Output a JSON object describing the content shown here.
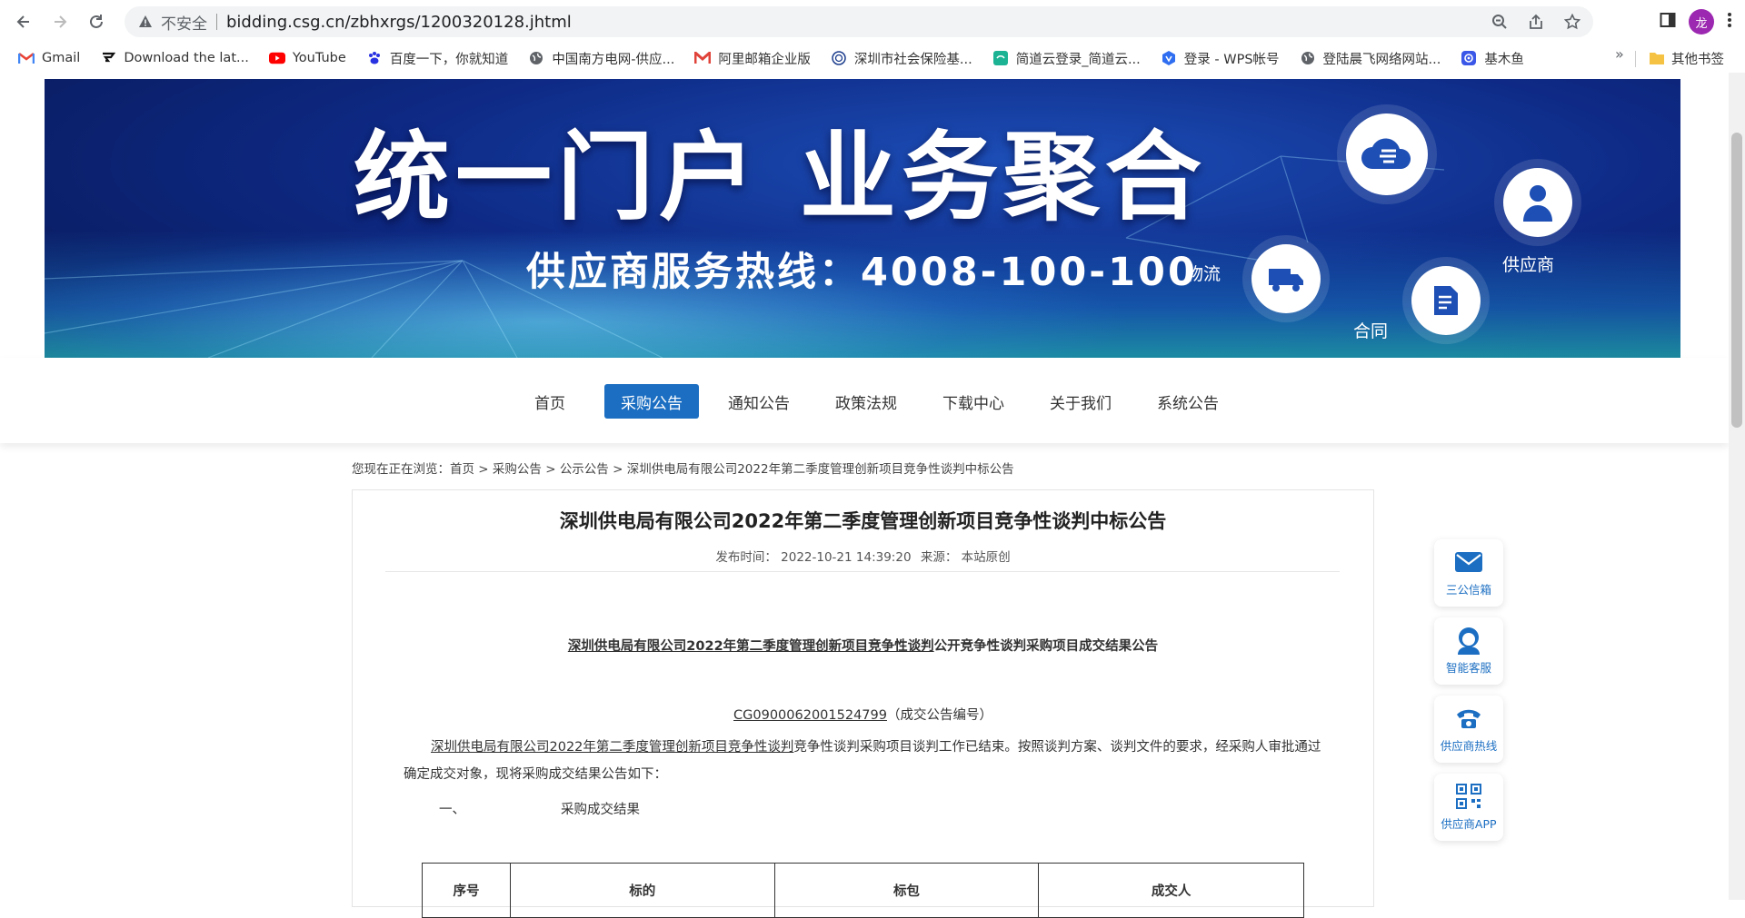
{
  "browser": {
    "security_label": "不安全",
    "url": "bidding.csg.cn/zbhxrgs/1200320128.jhtml",
    "avatar_text": "龙"
  },
  "bookmarks": {
    "items": [
      {
        "label": "Gmail",
        "icon": "gmail-icon"
      },
      {
        "label": "Download the lat...",
        "icon": "download-icon"
      },
      {
        "label": "YouTube",
        "icon": "youtube-icon"
      },
      {
        "label": "百度一下，你就知道",
        "icon": "baidu-icon"
      },
      {
        "label": "中国南方电网-供应...",
        "icon": "globe-icon"
      },
      {
        "label": "阿里邮箱企业版",
        "icon": "mail-icon"
      },
      {
        "label": "深圳市社会保险基...",
        "icon": "shield-icon"
      },
      {
        "label": "简道云登录_简道云...",
        "icon": "jiandaoyun-icon"
      },
      {
        "label": "登录 - WPS帐号",
        "icon": "wps-icon"
      },
      {
        "label": "登陆晨飞网络网站...",
        "icon": "globe-icon"
      },
      {
        "label": "基木鱼",
        "icon": "fish-icon"
      }
    ],
    "other": "其他书签"
  },
  "banner": {
    "title": "统一门户  业务聚合",
    "hotline": "供应商服务热线：4008-100-100",
    "labels": {
      "logistics": "物流",
      "contract": "合同",
      "supplier": "供应商"
    }
  },
  "menu": {
    "items": [
      "首页",
      "采购公告",
      "通知公告",
      "政策法规",
      "下载中心",
      "关于我们",
      "系统公告"
    ],
    "active": "采购公告"
  },
  "breadcrumb": {
    "prefix": "您现在正在浏览：",
    "items": [
      "首页",
      "采购公告",
      "公示公告",
      "深圳供电局有限公司2022年第二季度管理创新项目竞争性谈判中标公告"
    ],
    "separator": " > "
  },
  "article": {
    "title": "深圳供电局有限公司2022年第二季度管理创新项目竞争性谈判中标公告",
    "publish_label": "发布时间：",
    "publish_time": "2022-10-21 14:39:20",
    "source_label": "来源：",
    "source": "本站原创",
    "subtitle_underlined": "深圳供电局有限公司2022年第二季度管理创新项目竞争性谈判",
    "subtitle_rest": "公开竞争性谈判采购项目成交结果公告",
    "code": "CG0900062001524799",
    "code_note": "（成交公告编号）",
    "para_underlined": "深圳供电局有限公司2022年第二季度管理创新项目竞争性谈判",
    "para_rest": "竞争性谈判采购项目谈判工作已结束。按照谈判方案、谈判文件的要求，经采购人审批通过确定成交对象，现将采购成交结果公告如下：",
    "section_num": "一、",
    "section_title": "采购成交结果",
    "table_headers": [
      "序号",
      "标的",
      "标包",
      "成交人"
    ]
  },
  "tools": [
    {
      "label": "三公信箱",
      "icon": "mail-envelope-icon"
    },
    {
      "label": "智能客服",
      "icon": "customer-service-icon"
    },
    {
      "label": "供应商热线",
      "icon": "phone-icon"
    },
    {
      "label": "供应商APP",
      "icon": "qrcode-icon"
    }
  ],
  "colors": {
    "accent": "#1b6ec2"
  }
}
